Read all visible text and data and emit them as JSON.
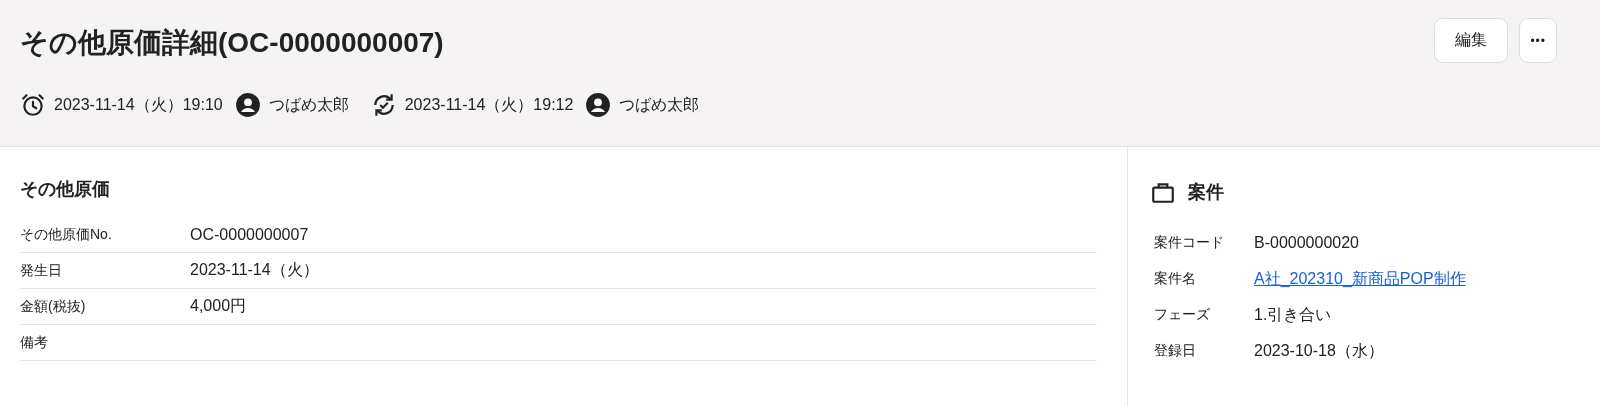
{
  "header": {
    "title": "その他原価詳細(OC-0000000007)",
    "buttons": [
      {
        "kind": "edit",
        "label": "編集"
      },
      {
        "kind": "more",
        "label": "•••"
      }
    ],
    "meta": [
      {
        "kind": "created",
        "datetime": "2023-11-14（火）19:10",
        "user": "つばめ太郎"
      },
      {
        "kind": "updated",
        "datetime": "2023-11-14（火）19:12",
        "user": "つばめ太郎"
      }
    ]
  },
  "main_section": {
    "title": "その他原価",
    "fields": [
      {
        "label": "その他原価No.",
        "value": "OC-0000000007"
      },
      {
        "label": "発生日",
        "value": "2023-11-14（火）"
      },
      {
        "label": "金額(税抜)",
        "value": "4,000円"
      },
      {
        "label": "備考"
      }
    ]
  },
  "side_section": {
    "title": "案件",
    "fields": [
      {
        "label": "案件コード",
        "kind": "text",
        "value": "B-0000000020"
      },
      {
        "label": "案件名",
        "kind": "link",
        "value": "A社_202310_新商品POP制作"
      },
      {
        "label": "フェーズ",
        "kind": "text",
        "value": "1.引き合い"
      },
      {
        "label": "登録日",
        "kind": "text",
        "value": "2023-10-18（水）"
      }
    ]
  }
}
